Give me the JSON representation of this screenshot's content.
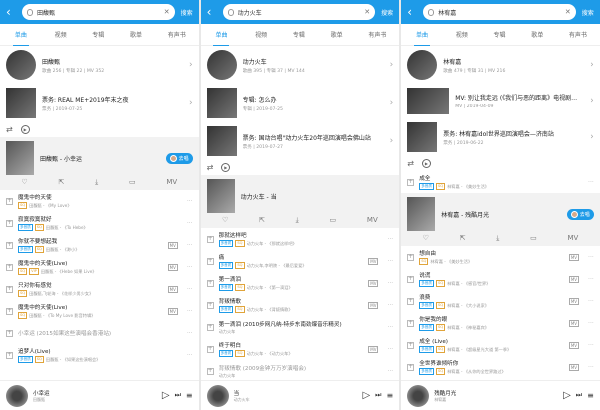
{
  "colors": {
    "accent": "#1e9be8",
    "tag_gold": "#e0a43a"
  },
  "search_label": "搜索",
  "tabs": [
    "单曲",
    "视频",
    "专辑",
    "歌单",
    "有声书"
  ],
  "panels": [
    {
      "query": "田馥甄",
      "cards": [
        {
          "title": "田馥甄",
          "sub": "歌曲 256 | 专辑 22 | MV 352"
        },
        {
          "title": "票务: REAL ME+2019年末之夜",
          "sub": "票务 | 2019-07-25"
        }
      ],
      "hero": {
        "title": "田馥甄 - 小幸运",
        "badge": "去唱"
      },
      "songs": [
        {
          "name": "魔鬼中的天使",
          "tags": [
            "SQ"
          ],
          "artist": "田馥甄 - 《My Love》",
          "mv": false
        },
        {
          "name": "寂寞寂寞就好",
          "tags": [
            "多音质",
            "SQ"
          ],
          "artist": "田馥甄 - 《To Hebe》",
          "mv": false
        },
        {
          "name": "你就不要想起我",
          "tags": [
            "多音质",
            "SQ"
          ],
          "artist": "田馥甄 - 《渺小》",
          "mv": true
        },
        {
          "name": "魔鬼中的天使(Live)",
          "tags": [
            "SQ",
            "VIP"
          ],
          "artist": "田馥甄 - 《Hebe 如果 Live》",
          "mv": true
        },
        {
          "name": "只对你有感觉",
          "tags": [
            "SQ"
          ],
          "artist": "田馥甄,飞轮海 - 《花样少男少女》",
          "mv": true
        },
        {
          "name": "魔鬼中的天使(Live)",
          "tags": [
            "SQ"
          ],
          "artist": "田馥甄 - 《To My Love 影音特辑》",
          "mv": true
        },
        {
          "name": "小幸运 (2015如果这些演唱会香港站)",
          "tags": [],
          "artist": "",
          "mv": false,
          "gray": true
        },
        {
          "name": "追梦人(Live)",
          "tags": [
            "多音质",
            "SQ"
          ],
          "artist": "田馥甄 - 《如果这些演唱会》",
          "mv": false
        }
      ],
      "player": {
        "title": "小幸运",
        "desc": "田馥甄",
        "progress": 0.02
      }
    },
    {
      "query": "动力火车",
      "cards": [
        {
          "title": "动力火车",
          "sub": "歌曲 395 | 专辑 37 | MV 144"
        },
        {
          "title": "专辑: 怎么办",
          "sub": "专辑 | 2019-07-25"
        },
        {
          "title": "票务: 国动台唱\"动力火车20年巡回演唱会佛山站",
          "sub": "票务 | 2019-07-27"
        }
      ],
      "hero": {
        "title": "动力火车 - 当",
        "badge": ""
      },
      "songs": [
        {
          "name": "那就这样吧",
          "tags": [
            "多音质",
            "SQ"
          ],
          "artist": "动力火车 - 《那就这样吧》",
          "mv": false
        },
        {
          "name": "痛",
          "tags": [
            "多音质",
            "SQ"
          ],
          "artist": "动力火车,李明陵 - 《最后爱爱》",
          "mv": true
        },
        {
          "name": "第一滴泪",
          "tags": [
            "多音质",
            "SQ"
          ],
          "artist": "动力火车 - 《第一滴泪》",
          "mv": true
        },
        {
          "name": "背叛情歌",
          "tags": [
            "多音质",
            "SQ"
          ],
          "artist": "动力火车 - 《背叛情歌》",
          "mv": true
        },
        {
          "name": "第一滴泪 (2010步网凡纳-特步东南劲爆音乐精灵)",
          "tags": [],
          "artist": "动力火车",
          "mv": false
        },
        {
          "name": "终于明白",
          "tags": [
            "多音质",
            "SQ"
          ],
          "artist": "动力火车 - 《动力火车》",
          "mv": true
        },
        {
          "name": "背叛情歌 (2009金钟万万岁演唱会)",
          "tags": [],
          "artist": "动力火车",
          "mv": false,
          "gray": true
        }
      ],
      "player": {
        "title": "当",
        "desc": "动力火车",
        "progress": 0.02
      }
    },
    {
      "query": "林宥嘉",
      "cards": [
        {
          "title": "林宥嘉",
          "sub": "歌曲 479 | 专辑 31 | MV 216"
        },
        {
          "title": "MV: 别让我走远 (《我们与恶的距离》电视剧…",
          "sub": "MV | 2019-04-09"
        },
        {
          "title": "票务: 林宥嘉idol世界巡回演唱会—济南站",
          "sub": "票务 | 2019-06-22"
        }
      ],
      "hero": {
        "title": "林宥嘉 - 残酷月光",
        "badge": "去唱"
      },
      "pre_song": {
        "name": "成全",
        "tags": [
          "多音质",
          "SQ"
        ],
        "artist": "林宥嘉 - 《美妙生活》"
      },
      "songs": [
        {
          "name": "想自由",
          "tags": [
            "SQ"
          ],
          "artist": "林宥嘉 - 《美妙生活》",
          "mv": true
        },
        {
          "name": "说谎",
          "tags": [
            "多音质",
            "SQ"
          ],
          "artist": "林宥嘉 - 《感官/世界》",
          "mv": true
        },
        {
          "name": "浪费",
          "tags": [
            "多音质",
            "SQ"
          ],
          "artist": "林宥嘉 - 《大小说家》",
          "mv": true
        },
        {
          "name": "你是我的眼",
          "tags": [
            "多音质",
            "SQ"
          ],
          "artist": "林宥嘉 - 《神秘嘉宾》",
          "mv": true
        },
        {
          "name": "成全 (Live)",
          "tags": [
            "多音质",
            "SQ"
          ],
          "artist": "林宥嘉 - 《超级星光大道 第一季》",
          "mv": true
        },
        {
          "name": "全世界谁倾听你",
          "tags": [
            "多音质",
            "SQ"
          ],
          "artist": "林宥嘉 - 《从你的全世界路过》",
          "mv": true
        }
      ],
      "player": {
        "title": "残酷月光",
        "desc": "林宥嘉",
        "progress": 0.02
      }
    }
  ]
}
